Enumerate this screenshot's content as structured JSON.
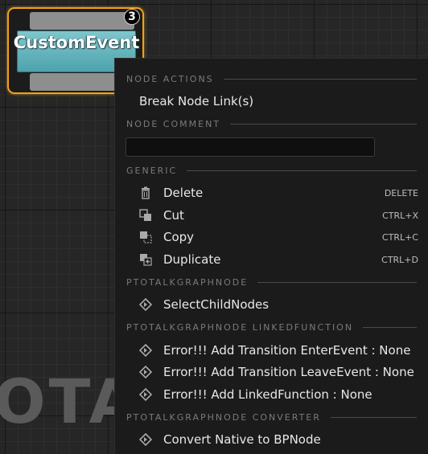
{
  "graph": {
    "watermark": "OTA"
  },
  "node": {
    "title": "CustomEvent",
    "badge": "3"
  },
  "menu": {
    "sections": {
      "node_actions": "NODE ACTIONS",
      "node_comment": "NODE COMMENT",
      "generic": "GENERIC",
      "ptotalk": "PTOTALKGRAPHNODE",
      "ptotalk_linked": "PTOTALKGRAPHNODE LINKEDFUNCTION",
      "ptotalk_converter": "PTOTALKGRAPHNODE CONVERTER"
    },
    "node_actions": {
      "break_links": "Break Node Link(s)"
    },
    "comment": {
      "value": ""
    },
    "generic": {
      "delete": {
        "label": "Delete",
        "shortcut": "DELETE"
      },
      "cut": {
        "label": "Cut",
        "shortcut": "CTRL+X"
      },
      "copy": {
        "label": "Copy",
        "shortcut": "CTRL+C"
      },
      "duplicate": {
        "label": "Duplicate",
        "shortcut": "CTRL+D"
      }
    },
    "ptotalk": {
      "select_child": "SelectChildNodes"
    },
    "linked": {
      "enter": "Error!!! Add Transition EnterEvent : None",
      "leave": "Error!!! Add Transition LeaveEvent : None",
      "linked_fn": "Error!!! Add LinkedFunction : None"
    },
    "converter": {
      "convert": "Convert Native to BPNode"
    }
  },
  "colors": {
    "node_border": "#f0a21c",
    "node_title": "#5fb3bc",
    "menu_bg": "#1b1b1b"
  }
}
